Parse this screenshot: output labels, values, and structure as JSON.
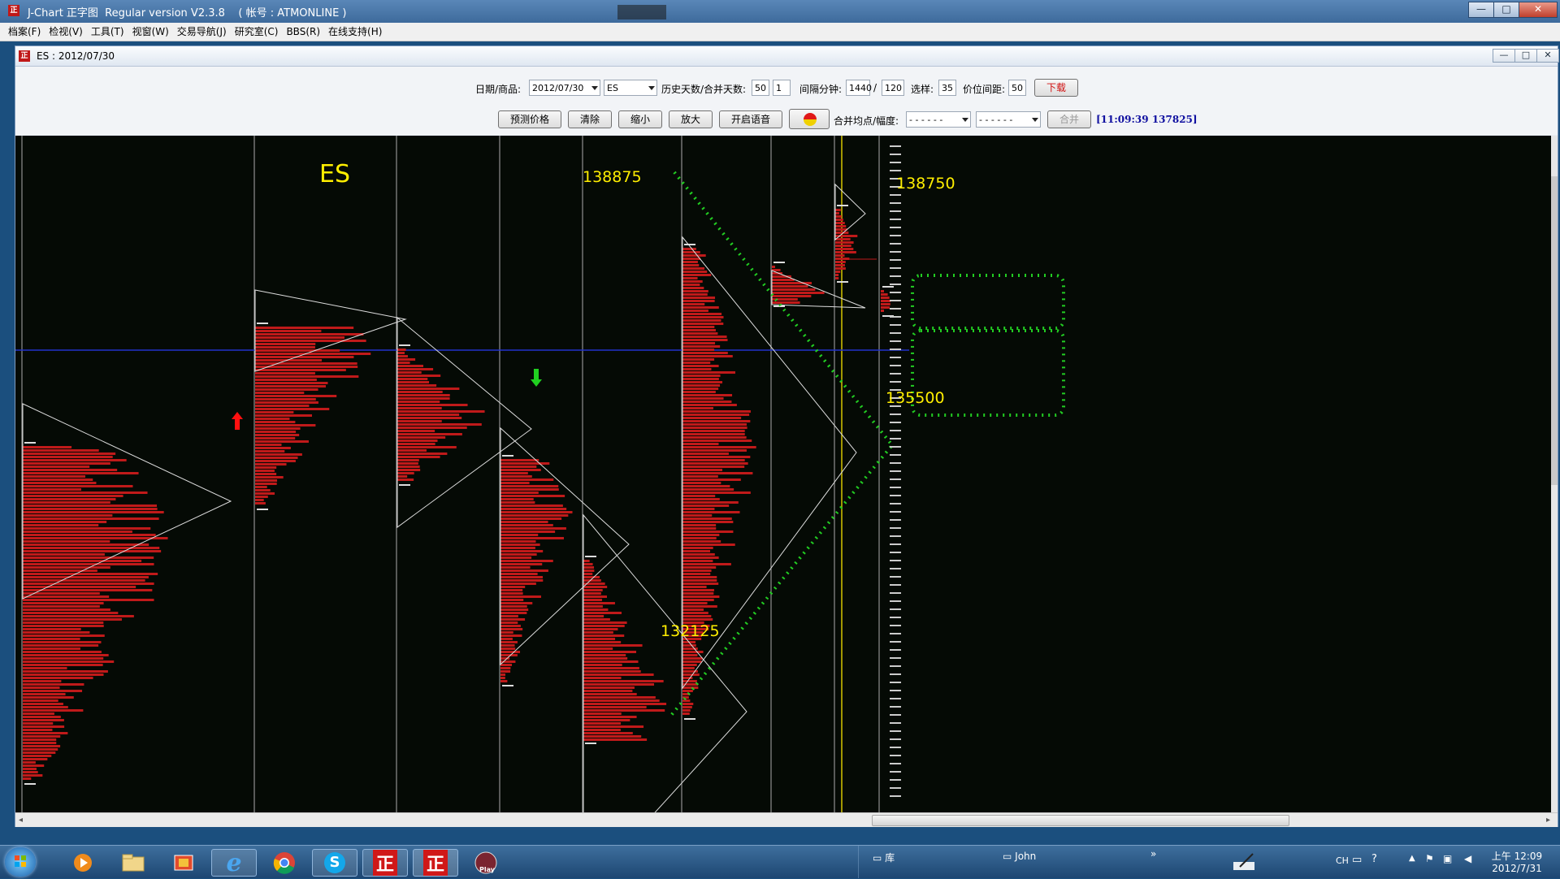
{
  "window": {
    "title": "J-Chart 正字图  Regular version V2.3.8    ( 帐号 : ATMONLINE )",
    "app_tag": "正",
    "minimize": "—",
    "maximize": "□",
    "close": "✕"
  },
  "menu": [
    "档案(F)",
    "检视(V)",
    "工具(T)",
    "视窗(W)",
    "交易导航(J)",
    "研究室(C)",
    "BBS(R)",
    "在线支持(H)"
  ],
  "child_window": {
    "title": "ES : 2012/07/30"
  },
  "toolbar": {
    "date_label": "日期/商品:",
    "date_value": "2012/07/30",
    "symbol_value": "ES",
    "history_label": "历史天数/合并天数:",
    "history_days": "50",
    "merge_days": "1",
    "interval_label": "间隔分钟:",
    "interval_a": "1440",
    "interval_sep": "/",
    "interval_b": "120",
    "select_label": "选样:",
    "select_value": "35",
    "tick_label": "价位间距:",
    "tick_value": "50",
    "download": "下载",
    "predict": "预测价格",
    "clear": "清除",
    "shrink": "缩小",
    "enlarge": "放大",
    "voice": "开启语音",
    "merge_label": "合并均点/幅度:",
    "dash_a": "- - - - - -",
    "dash_b": "- - - - - -",
    "merge_btn": "合并",
    "status": "[11:09:39 137825]"
  },
  "chart": {
    "symbol": "ES",
    "annotations": {
      "high_left": "138875",
      "high_right": "138750",
      "mid": "135500",
      "low": "132125"
    },
    "colors": {
      "profile": "#c01a1a",
      "guide": "#22cc22",
      "label": "#ffee00",
      "current_line": "#2233cc"
    }
  },
  "taskbar": {
    "start": "start-orb",
    "apps": [
      "media-player",
      "file-explorer",
      "toolbox",
      "internet-explorer",
      "chrome",
      "skype",
      "正",
      "正",
      "play"
    ],
    "library": "库",
    "user": "John",
    "lang": "CH",
    "time": "上午 12:09",
    "date": "2012/7/31"
  }
}
